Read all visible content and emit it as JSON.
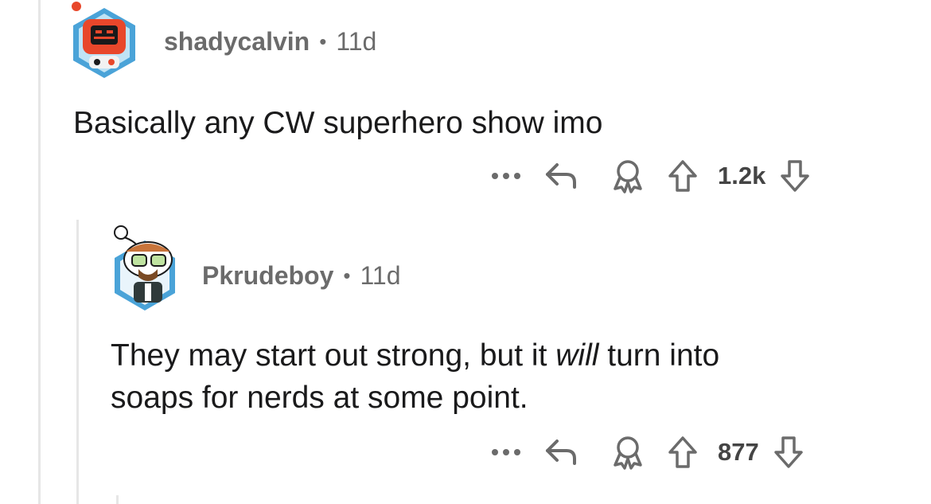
{
  "comments": [
    {
      "username": "shadycalvin",
      "separator": "•",
      "age": "11d",
      "text": "Basically any CW superhero show imo",
      "score": "1.2k",
      "icons": [
        "more-icon",
        "reply-icon",
        "award-icon",
        "upvote-icon",
        "downvote-icon"
      ]
    },
    {
      "username": "Pkrudeboy",
      "separator": "•",
      "age": "11d",
      "text_before": "They may start out strong, but it ",
      "text_emph": "will",
      "text_line1_after": " turn into",
      "text_line2": "soaps for nerds at some point.",
      "score": "877",
      "icons": [
        "more-icon",
        "reply-icon",
        "award-icon",
        "upvote-icon",
        "downvote-icon"
      ]
    }
  ],
  "colors": {
    "avatar_ring": "#4aa3d8",
    "bot_red": "#e8472b",
    "thread": "#e6e6e6",
    "meta": "#6b6b6b"
  }
}
